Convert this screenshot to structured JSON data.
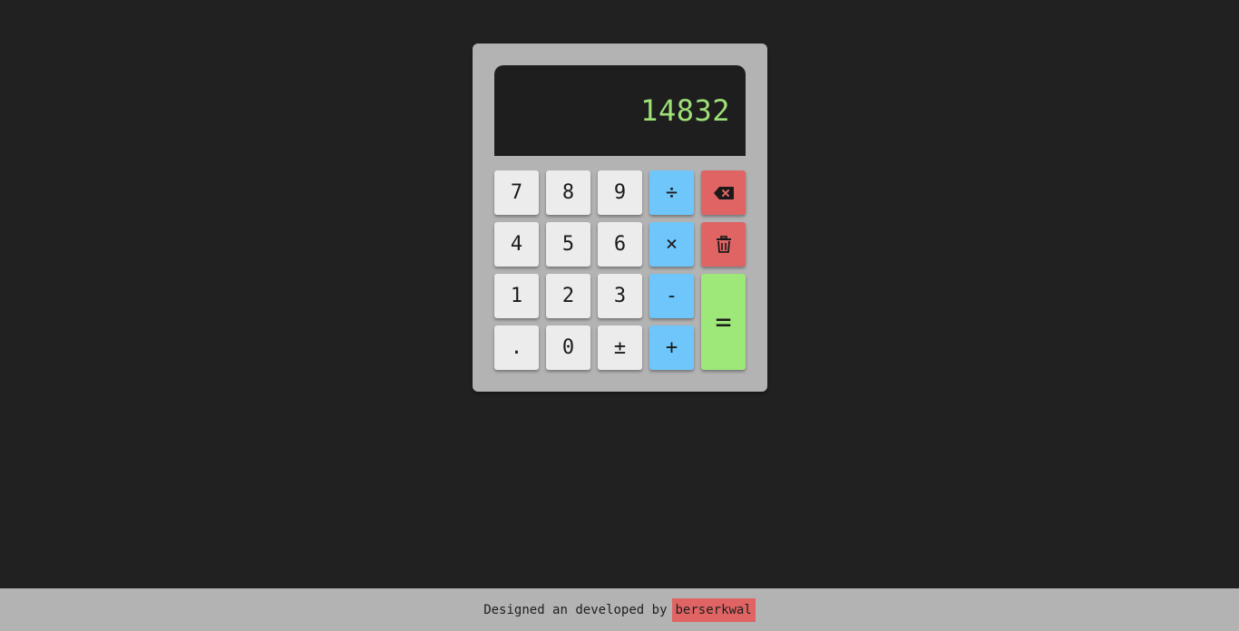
{
  "display": {
    "value": "14832"
  },
  "keys": {
    "seven": "7",
    "eight": "8",
    "nine": "9",
    "divide": "÷",
    "four": "4",
    "five": "5",
    "six": "6",
    "multiply": "×",
    "one": "1",
    "two": "2",
    "three": "3",
    "minus": "-",
    "decimal": ".",
    "zero": "0",
    "plus_minus": "±",
    "plus": "+",
    "equals": "=",
    "backspace_icon": "backspace-icon",
    "clear_icon": "trash-icon"
  },
  "footer": {
    "text": "Designed an developed by",
    "author": "berserkwal"
  },
  "colors": {
    "background": "#212121",
    "calculator_body": "#b3b3b3",
    "display_bg": "#1e1e1e",
    "display_text": "#9fe077",
    "number_key": "#ececec",
    "operator_key": "#6fc6fb",
    "danger_key": "#e06464",
    "equals_key": "#9de879"
  }
}
